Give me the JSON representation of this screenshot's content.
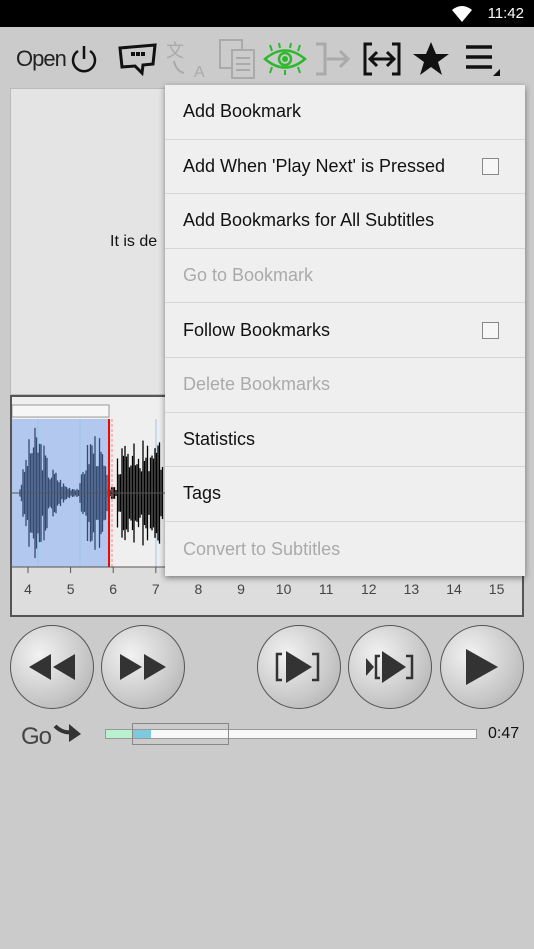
{
  "status_bar": {
    "time": "11:42"
  },
  "toolbar": {
    "open_label": "Open",
    "icons": [
      "power-icon",
      "subtitle-bubble-icon",
      "translate-icon",
      "copy-icon",
      "eye-icon",
      "jump-icon",
      "fit-width-icon",
      "star-icon",
      "menu-icon"
    ],
    "eye_color": "#2db82d"
  },
  "subtitle": {
    "text": "It is de"
  },
  "waveform": {
    "ticks": [
      "4",
      "5",
      "6",
      "7",
      "8",
      "9",
      "10",
      "11",
      "12",
      "13",
      "14",
      "15"
    ],
    "selection_color": "#b3c8ee",
    "cursor_color": "#ff0000"
  },
  "menu": {
    "items": [
      {
        "label": "Add Bookmark",
        "enabled": true
      },
      {
        "label": "Add When 'Play Next' is Pressed",
        "enabled": true,
        "checkbox": false
      },
      {
        "label": "Add Bookmarks for All Subtitles",
        "enabled": true
      },
      {
        "label": "Go to Bookmark",
        "enabled": false
      },
      {
        "label": "Follow Bookmarks",
        "enabled": true,
        "checkbox": false
      },
      {
        "label": "Delete Bookmarks",
        "enabled": false
      },
      {
        "label": "Statistics",
        "enabled": true
      },
      {
        "label": "Tags",
        "enabled": true
      },
      {
        "label": "Convert to Subtitles",
        "enabled": false
      }
    ]
  },
  "controls": {
    "buttons": [
      "rewind",
      "fast-forward",
      "play-subtitle",
      "play-next-subtitle",
      "play"
    ]
  },
  "bottom": {
    "go_label": "Go",
    "duration": "0:47",
    "progress_played_percent": 7,
    "progress_current_percent": 5
  }
}
